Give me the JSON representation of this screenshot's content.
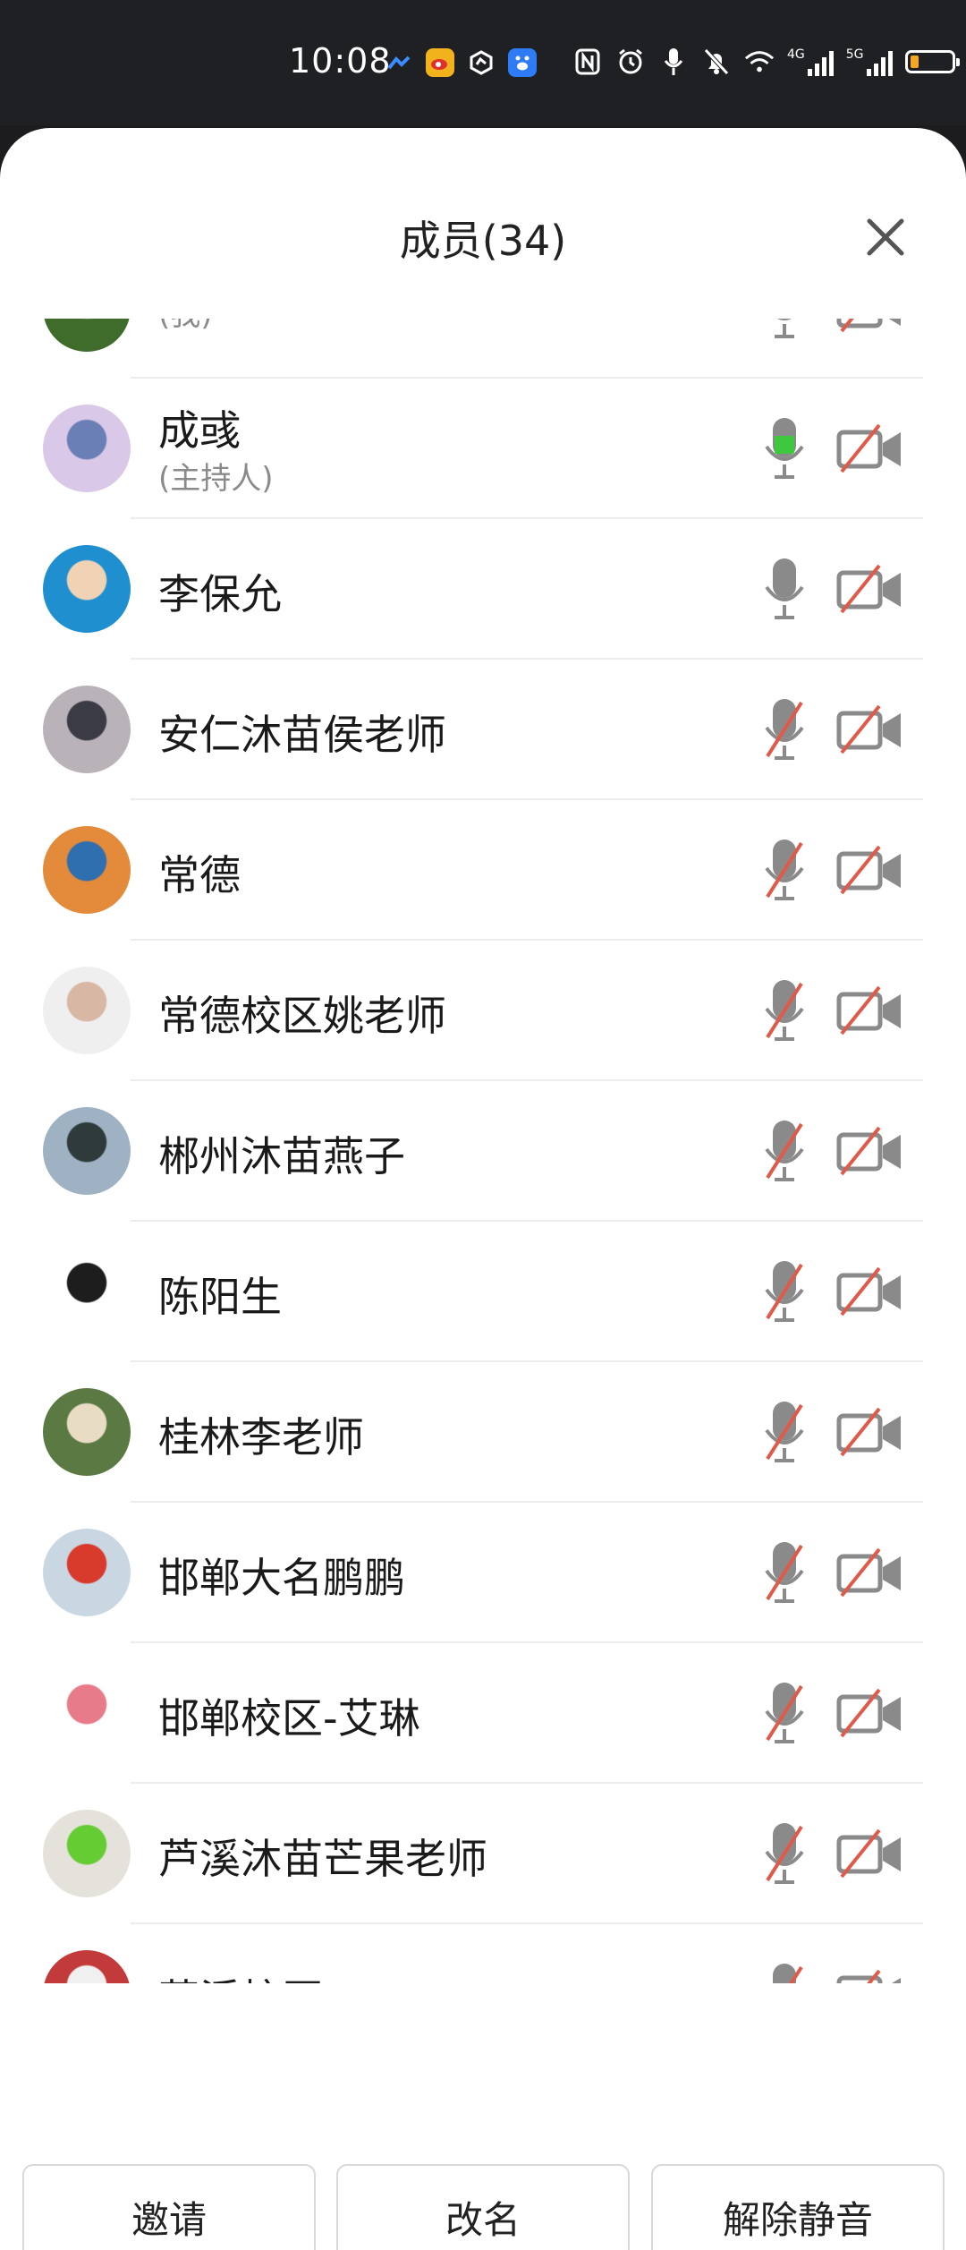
{
  "status_bar": {
    "time": "10:08",
    "network_4g": "4G",
    "network_5g": "5G",
    "battery_level": 0.2,
    "battery_color": "#f5a623",
    "icons": [
      "cloud-icon",
      "weibo-icon",
      "app-icon",
      "baidu-icon",
      "nfc-icon",
      "alarm-icon",
      "mic-icon",
      "mute-bell-icon",
      "wifi-icon",
      "signal-icon",
      "signal-icon",
      "battery-icon"
    ]
  },
  "sheet": {
    "title": "成员(34)",
    "close_icon": "close-icon"
  },
  "members": [
    {
      "name": "",
      "sub": "(我)",
      "mic": "active",
      "cam": "off",
      "partial": "top",
      "avatar_colors": [
        "#3f6b2b",
        "#7aa74a"
      ]
    },
    {
      "name": "成彧",
      "sub": "(主持人)",
      "mic": "speaking",
      "cam": "off",
      "avatar_colors": [
        "#d9c8e8",
        "#6a7fb5"
      ]
    },
    {
      "name": "李保允",
      "sub": "",
      "mic": "on",
      "cam": "off",
      "avatar_colors": [
        "#1f8fd0",
        "#f0d2b4"
      ]
    },
    {
      "name": "安仁沐苗侯老师",
      "sub": "",
      "mic": "muted",
      "cam": "off",
      "avatar_colors": [
        "#b9b2b8",
        "#3a3b45"
      ]
    },
    {
      "name": "常德",
      "sub": "",
      "mic": "muted",
      "cam": "off",
      "avatar_colors": [
        "#e38a3b",
        "#2f6fb0"
      ]
    },
    {
      "name": "常德校区姚老师",
      "sub": "",
      "mic": "muted",
      "cam": "off",
      "avatar_colors": [
        "#efefef",
        "#d8b7a5"
      ]
    },
    {
      "name": "郴州沐苗燕子",
      "sub": "",
      "mic": "muted",
      "cam": "off",
      "avatar_colors": [
        "#9eb2c4",
        "#2e3b3a"
      ]
    },
    {
      "name": "陈阳生",
      "sub": "",
      "mic": "muted",
      "cam": "off",
      "avatar_colors": [
        "#ffffff",
        "#1d1d1d"
      ]
    },
    {
      "name": "桂林李老师",
      "sub": "",
      "mic": "muted",
      "cam": "off",
      "avatar_colors": [
        "#5b7a43",
        "#e8dcc4"
      ]
    },
    {
      "name": "邯郸大名鹏鹏",
      "sub": "",
      "mic": "muted",
      "cam": "off",
      "avatar_colors": [
        "#c9d7e3",
        "#d83a2c"
      ]
    },
    {
      "name": "邯郸校区-艾琳",
      "sub": "",
      "mic": "muted",
      "cam": "off",
      "avatar_colors": [
        "#ffffff",
        "#e77b8a"
      ]
    },
    {
      "name": "芦溪沐苗芒果老师",
      "sub": "",
      "mic": "muted",
      "cam": "off",
      "avatar_colors": [
        "#e5e2dc",
        "#66cc33"
      ]
    },
    {
      "name": "芦溪校区",
      "sub": "",
      "mic": "muted",
      "cam": "off",
      "partial": "bottom",
      "avatar_colors": [
        "#c23a3a",
        "#f0f0f0"
      ]
    }
  ],
  "buttons": {
    "invite": "邀请",
    "rename": "改名",
    "unmute": "解除静音"
  },
  "colors": {
    "icon_gray": "#8a8a8a",
    "speaking_green": "#3ec83e",
    "muted_red": "#e05a4a"
  }
}
